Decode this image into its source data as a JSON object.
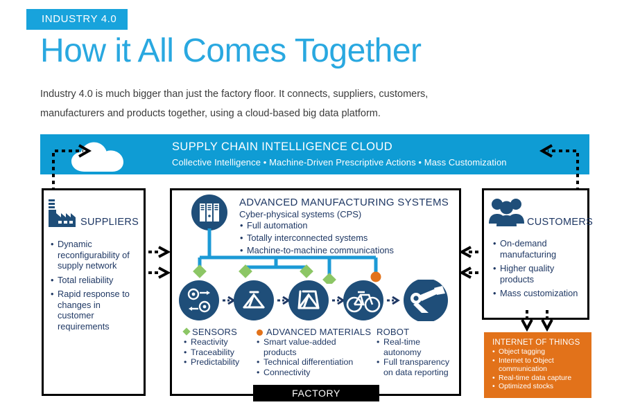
{
  "header": {
    "kicker": "INDUSTRY 4.0",
    "title": "How it All Comes Together",
    "intro": "Industry 4.0 is much bigger than just the factory floor. It connects, suppliers, customers, manufacturers and products together, using a cloud-based big data platform."
  },
  "cloud": {
    "title": "SUPPLY CHAIN INTELLIGENCE CLOUD",
    "subtitle": "Collective Intelligence • Machine-Driven Prescriptive Actions • Mass Customization",
    "icon": "cloud-icon",
    "bg_color": "#0F9CD4"
  },
  "suppliers": {
    "label": "SUPPLIERS",
    "icon": "factory-icon",
    "bullets": [
      "Dynamic reconfigurability of supply network",
      "Total reliability",
      "Rapid response to changes in customer requirements"
    ]
  },
  "center": {
    "title": "ADVANCED  MANUFACTURING SYSTEMS",
    "subtitle": "Cyber-physical systems (CPS)",
    "icon": "server-rack-icon",
    "bullets": [
      "Full automation",
      "Totally interconnected systems",
      "Machine-to-machine communications"
    ],
    "process_icons": [
      "design-gears-icon",
      "bicycle-frame-icon",
      "bicycle-frame-fork-icon",
      "complete-bicycle-icon",
      "robot-arm-icon"
    ],
    "legend": [
      {
        "marker": "diamond",
        "marker_color": "#8CC665",
        "title": "SENSORS",
        "bullets": [
          "Reactivity",
          "Traceability",
          "Predictability"
        ]
      },
      {
        "marker": "circle",
        "marker_color": "#E2721A",
        "title": "ADVANCED MATERIALS",
        "bullets": [
          "Smart value-added products",
          "Technical differentiation",
          "Connectivity"
        ]
      },
      {
        "marker": "none",
        "marker_color": "",
        "title": "ROBOT",
        "bullets": [
          "Real-time autonomy",
          "Full transparency on data reporting"
        ]
      }
    ],
    "factory_label": "FACTORY"
  },
  "customers": {
    "label": "CUSTOMERS",
    "icon": "people-group-icon",
    "bullets": [
      "On-demand manufacturing",
      "Higher quality products",
      "Mass customization"
    ]
  },
  "iot": {
    "title": "INTERNET OF THINGS",
    "bg_color": "#E2721A",
    "bullets": [
      "Object tagging",
      "Internet to Object communication",
      "Real-time data capture",
      "Optimized stocks"
    ]
  },
  "colors": {
    "brand_blue": "#29A8E0",
    "banner_blue": "#0F9CD4",
    "navy": "#1F4E79",
    "text_navy": "#1F3864",
    "orange": "#E2721A",
    "green": "#8CC665",
    "connector_blue": "#1C9AD6"
  }
}
